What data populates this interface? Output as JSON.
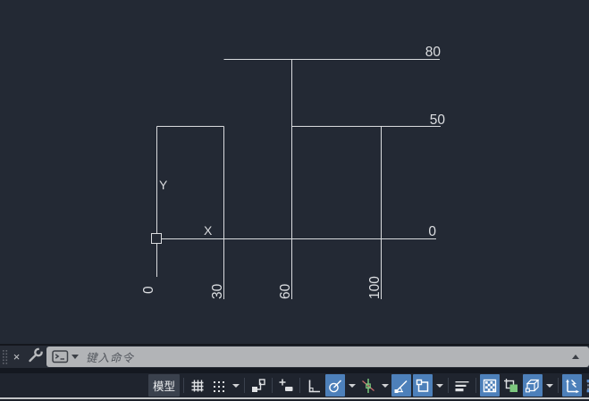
{
  "colors": {
    "canvas_bg": "#232934",
    "line": "#d9dbde",
    "active_button_blue": "#4d80ba",
    "accent_green": "#7cc77e",
    "accent_red": "#c96b6b"
  },
  "drawing": {
    "right_dim_labels": [
      {
        "value": "80"
      },
      {
        "value": "50"
      },
      {
        "value": "0"
      }
    ],
    "bottom_dim_labels": [
      {
        "value": "0"
      },
      {
        "value": "30"
      },
      {
        "value": "60"
      },
      {
        "value": "100"
      }
    ],
    "ucs": {
      "x": "X",
      "y": "Y"
    }
  },
  "command_bar": {
    "close_label": "×",
    "placeholder": "键入命令",
    "icons": [
      "grip-dots-icon",
      "close-icon",
      "wrench-icon",
      "command-prompt-icon",
      "chevron-down-icon",
      "expand-up-icon"
    ]
  },
  "status_bar": {
    "model_label": "模型",
    "buttons": [
      {
        "name": "grid-display",
        "active": false
      },
      {
        "name": "snap-mode",
        "active": false,
        "flyout": true
      },
      {
        "name": "infer-constraints",
        "active": false
      },
      {
        "name": "dynamic-input",
        "active": false
      },
      {
        "name": "ortho-mode",
        "active": false
      },
      {
        "name": "polar-tracking",
        "active": true,
        "flyout": true
      },
      {
        "name": "isometric-drafting",
        "active": false,
        "flyout": true
      },
      {
        "name": "object-snap-tracking",
        "active": true
      },
      {
        "name": "object-snap-2d",
        "active": true,
        "flyout": true
      },
      {
        "name": "lineweight",
        "active": false
      },
      {
        "name": "transparency",
        "active": true
      },
      {
        "name": "selection-cycling",
        "active": false
      },
      {
        "name": "object-snap-3d",
        "active": true,
        "flyout": true
      },
      {
        "name": "dynamic-ucs",
        "active": true
      },
      {
        "name": "selection-filtering",
        "active": false,
        "flyout": true
      }
    ]
  }
}
